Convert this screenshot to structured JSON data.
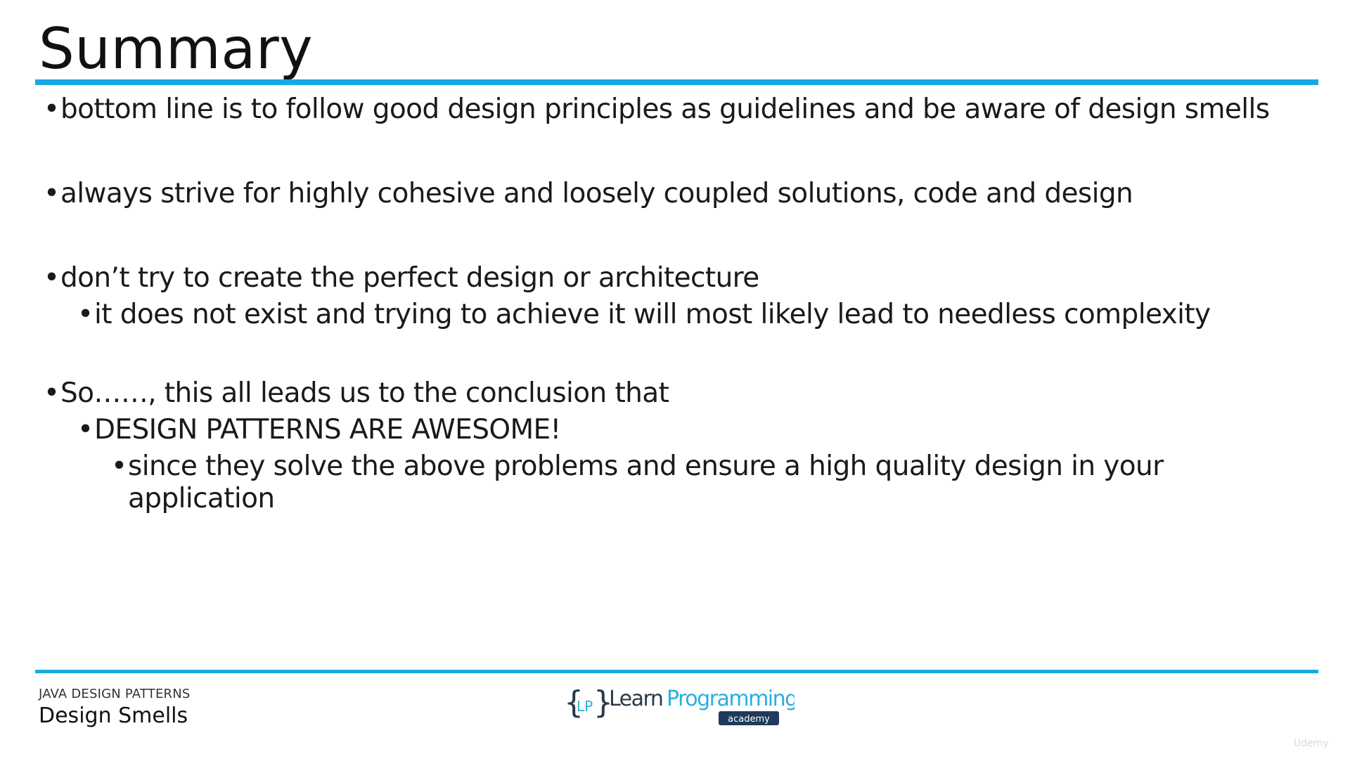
{
  "slide": {
    "title": "Summary",
    "bullets": [
      {
        "level": 1,
        "text": "bottom line is to follow good design principles as guidelines and be aware of design smells"
      },
      {
        "level": 1,
        "text": "always strive for highly cohesive and loosely coupled solutions, code and design"
      },
      {
        "level": 1,
        "text": "don’t try to create the perfect design or architecture"
      },
      {
        "level": 2,
        "text": "it does not exist and trying to achieve it will most likely lead to needless complexity"
      },
      {
        "level": 1,
        "text": "So……, this all leads us to the conclusion that"
      },
      {
        "level": 2,
        "text": "DESIGN PATTERNS ARE AWESOME!"
      },
      {
        "level": 3,
        "text": "since they solve the above problems and ensure a high quality design in your application"
      }
    ],
    "bullet_symbol": "•"
  },
  "footer": {
    "course": "JAVA DESIGN PATTERNS",
    "section": "Design Smells"
  },
  "logo": {
    "text_part1": "Learn",
    "text_part2": "Programming",
    "sub": "academy",
    "mark": "LP"
  },
  "watermark": "Udemy",
  "colors": {
    "accent": "#16a9e4",
    "text": "#1a1a1a",
    "logo_dark": "#2b3a4a",
    "logo_blue": "#2aaee0",
    "logo_badge": "#1f3a5c"
  }
}
